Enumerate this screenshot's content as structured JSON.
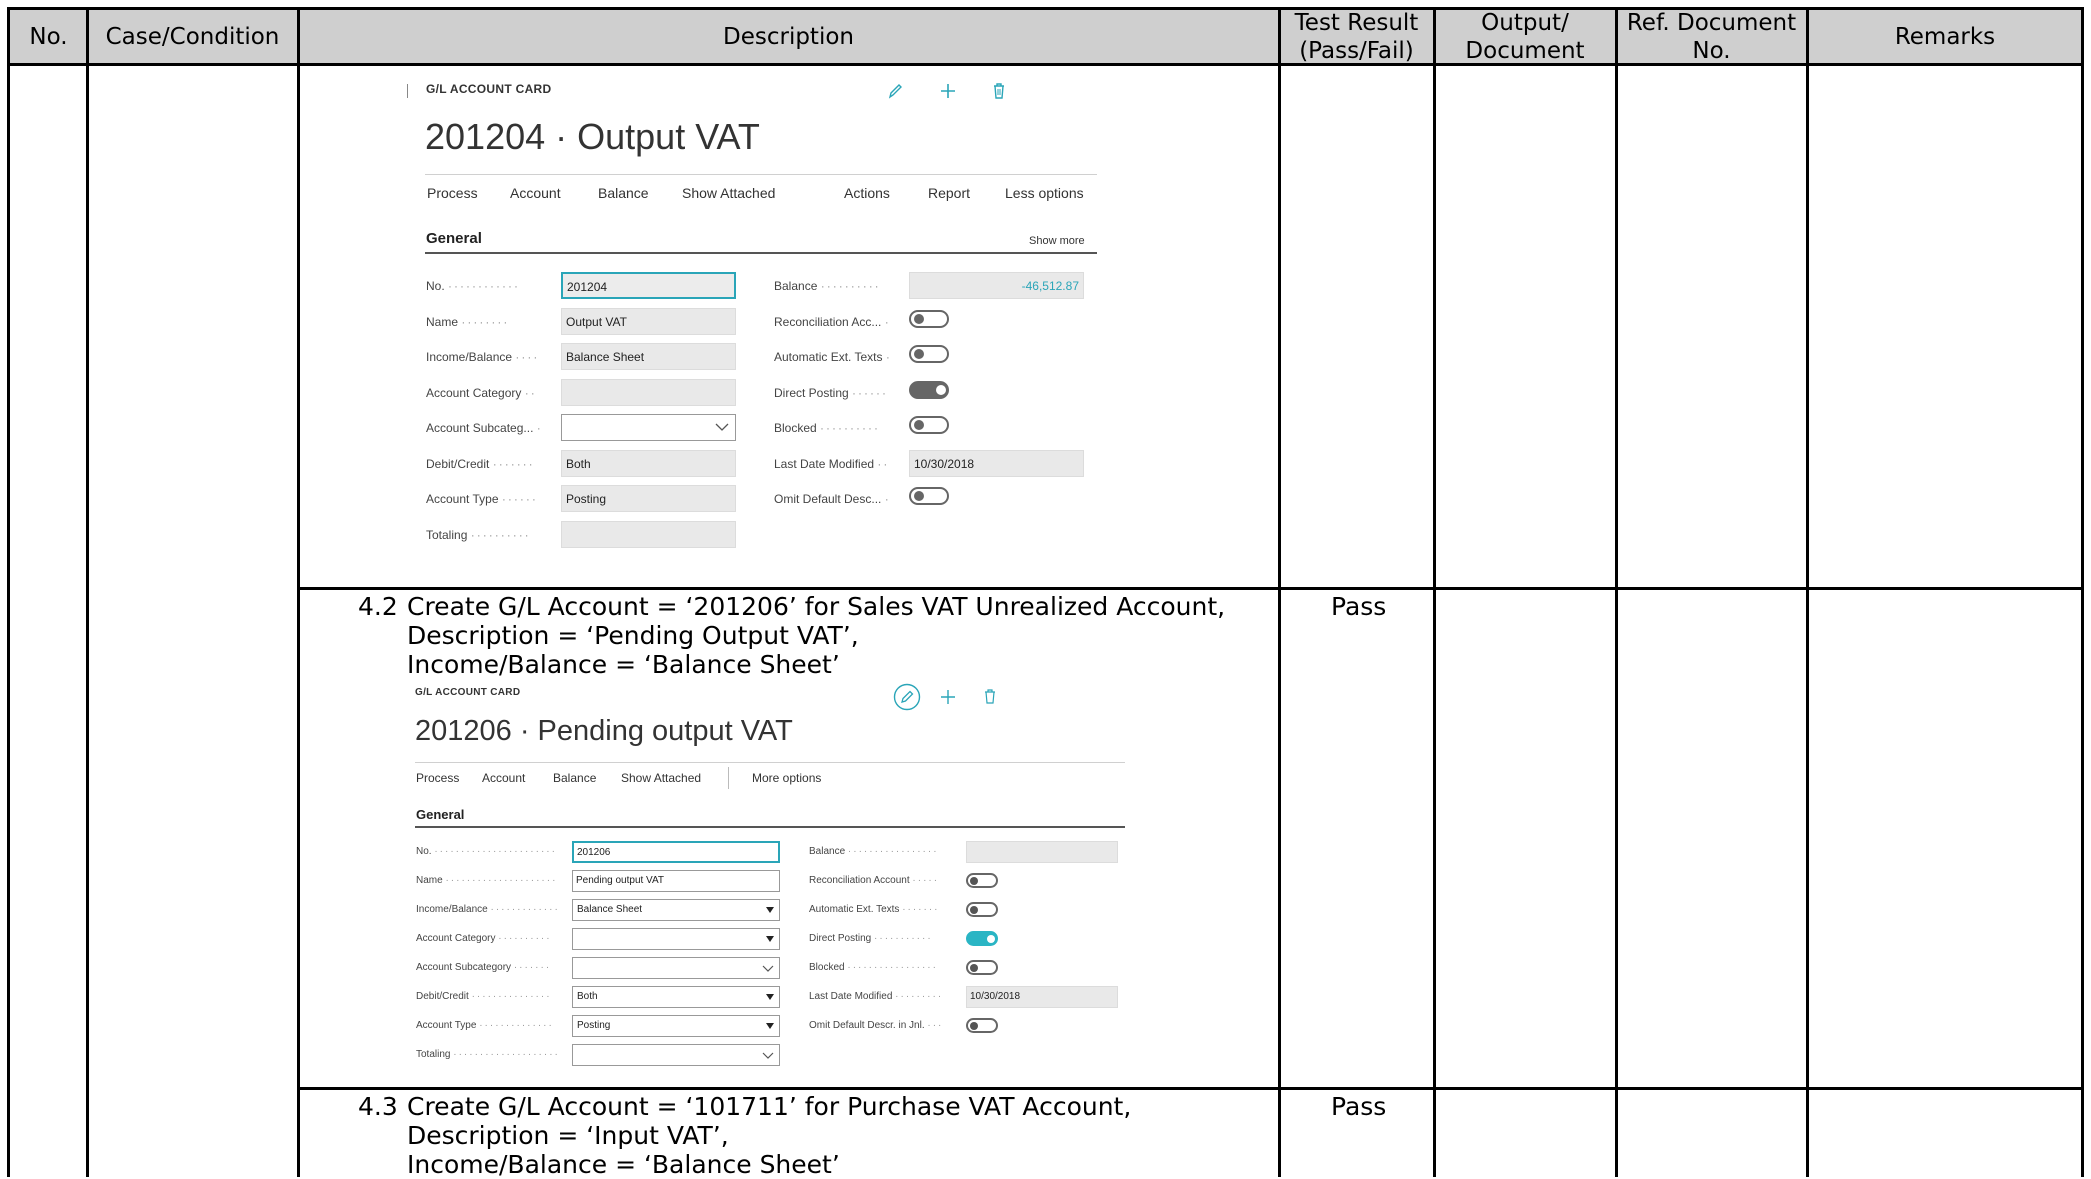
{
  "header": {
    "no": "No.",
    "case": "Case/Condition",
    "description": "Description",
    "test_result": "Test Result\n(Pass/Fail)",
    "output": "Output/\nDocument",
    "ref_doc": "Ref. Document\nNo.",
    "remarks": "Remarks"
  },
  "card1": {
    "crumb": "G/L ACCOUNT CARD",
    "title": "201204 · Output VAT",
    "actions": [
      "Process",
      "Account",
      "Balance",
      "Show Attached",
      "Actions",
      "Report",
      "Less options"
    ],
    "section": "General",
    "show_more": "Show more",
    "left_fields": [
      {
        "label": "No.",
        "value": "201204"
      },
      {
        "label": "Name",
        "value": "Output VAT"
      },
      {
        "label": "Income/Balance",
        "value": "Balance Sheet"
      },
      {
        "label": "Account Category",
        "value": ""
      },
      {
        "label": "Account Subcateg...",
        "value": ""
      },
      {
        "label": "Debit/Credit",
        "value": "Both"
      },
      {
        "label": "Account Type",
        "value": "Posting"
      },
      {
        "label": "Totaling",
        "value": ""
      }
    ],
    "right_fields": [
      {
        "label": "Balance",
        "value": "-46,512.87"
      },
      {
        "label": "Reconciliation Acc...",
        "toggle": false
      },
      {
        "label": "Automatic Ext. Texts",
        "toggle": false
      },
      {
        "label": "Direct Posting",
        "toggle": true
      },
      {
        "label": "Blocked",
        "toggle": false
      },
      {
        "label": "Last Date Modified",
        "value": "10/30/2018"
      },
      {
        "label": "Omit Default Desc...",
        "toggle": false
      }
    ]
  },
  "row42": {
    "num": "4.2",
    "lines": [
      "Create G/L Account = ‘201206’ for Sales VAT Unrealized Account,",
      "Description = ‘Pending Output VAT’,",
      "Income/Balance = ‘Balance Sheet’"
    ],
    "result": "Pass"
  },
  "card2": {
    "crumb": "G/L ACCOUNT CARD",
    "title": "201206 · Pending output VAT",
    "actions": [
      "Process",
      "Account",
      "Balance",
      "Show Attached",
      "More options"
    ],
    "section": "General",
    "left_fields": [
      {
        "label": "No.",
        "value": "201206"
      },
      {
        "label": "Name",
        "value": "Pending output VAT"
      },
      {
        "label": "Income/Balance",
        "value": "Balance Sheet"
      },
      {
        "label": "Account Category",
        "value": ""
      },
      {
        "label": "Account Subcategory",
        "value": ""
      },
      {
        "label": "Debit/Credit",
        "value": "Both"
      },
      {
        "label": "Account Type",
        "value": "Posting"
      },
      {
        "label": "Totaling",
        "value": ""
      }
    ],
    "right_fields": [
      {
        "label": "Balance",
        "value": ""
      },
      {
        "label": "Reconciliation Account",
        "toggle": false
      },
      {
        "label": "Automatic Ext. Texts",
        "toggle": false
      },
      {
        "label": "Direct Posting",
        "toggle": true
      },
      {
        "label": "Blocked",
        "toggle": false
      },
      {
        "label": "Last Date Modified",
        "value": "10/30/2018"
      },
      {
        "label": "Omit Default Descr. in Jnl.",
        "toggle": false
      }
    ]
  },
  "row43": {
    "num": "4.3",
    "lines": [
      "Create G/L Account = ‘101711’ for Purchase VAT Account,",
      "Description = ‘Input VAT’,",
      "Income/Balance = ‘Balance Sheet’"
    ],
    "result": "Pass"
  },
  "colors": {
    "accent": "#2aa5b8",
    "header_bg": "#cfcfcf",
    "toggle_on": "#2ab5c4",
    "toggle_on_gray": "#666666"
  }
}
